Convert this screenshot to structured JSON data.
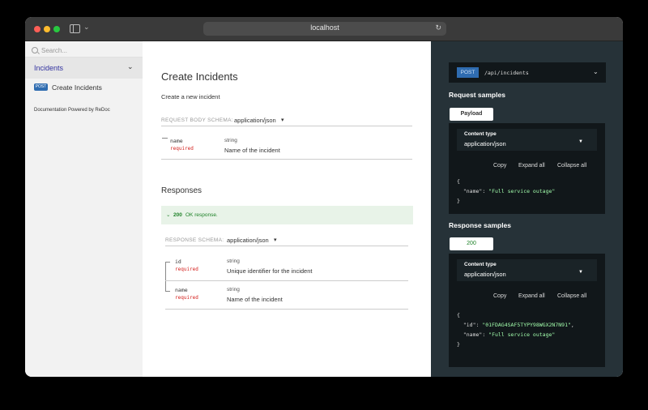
{
  "browser": {
    "url": "localhost"
  },
  "sidebar": {
    "search_placeholder": "Search...",
    "group_label": "Incidents",
    "item_method": "POST",
    "item_label": "Create Incidents",
    "powered_by": "Documentation Powered by ReDoc"
  },
  "operation": {
    "title": "Create Incidents",
    "description": "Create a new incident",
    "request_schema_label": "REQUEST BODY SCHEMA:",
    "request_content_type": "application/json",
    "request_fields": [
      {
        "name": "name",
        "required": "required",
        "type": "string",
        "description": "Name of the incident"
      }
    ],
    "responses_title": "Responses",
    "response_code": "200",
    "response_text": "OK response.",
    "response_schema_label": "RESPONSE SCHEMA:",
    "response_content_type": "application/json",
    "response_fields": [
      {
        "name": "id",
        "required": "required",
        "type": "string",
        "description": "Unique identifier for the incident"
      },
      {
        "name": "name",
        "required": "required",
        "type": "string",
        "description": "Name of the incident"
      }
    ]
  },
  "right_panel": {
    "method": "POST",
    "path": "/api/incidents",
    "request_samples_title": "Request samples",
    "request_tab": "Payload",
    "request_content_type_label": "Content type",
    "request_content_type": "application/json",
    "copy": "Copy",
    "expand_all": "Expand all",
    "collapse_all": "Collapse all",
    "request_sample": {
      "name": "Full service outage"
    },
    "response_samples_title": "Response samples",
    "response_tab": "200",
    "response_content_type_label": "Content type",
    "response_content_type": "application/json",
    "response_sample": {
      "id": "01FDAG4SAF5TYPY98WGX2N7N91",
      "name": "Full service outage"
    }
  },
  "colors": {
    "accent": "#32329f",
    "post_badge": "#2f6cb0",
    "required": "#d41f1c",
    "success": "#1d8127",
    "dark_panel": "#263238",
    "code_bg": "#11171a",
    "code_string": "#a0fbaa"
  },
  "icons": [
    "search-icon",
    "chevron-down-icon",
    "sidebar-toggle-icon",
    "reload-icon",
    "caret-down-icon"
  ]
}
